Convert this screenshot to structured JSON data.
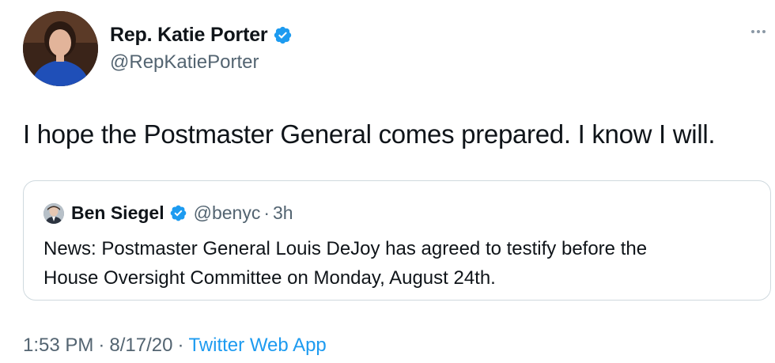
{
  "author": {
    "display_name": "Rep. Katie Porter",
    "handle": "@RepKatiePorter",
    "verified": true
  },
  "tweet": {
    "text": "I hope the Postmaster General comes prepared. I know I will."
  },
  "quoted_tweet": {
    "display_name": "Ben Siegel",
    "verified": true,
    "handle": "@benyc",
    "separator": "·",
    "time": "3h",
    "text_line1": "News: Postmaster General Louis DeJoy has agreed to testify before the",
    "text_line2": "House Oversight Committee on Monday, August 24th."
  },
  "meta": {
    "time": "1:53 PM",
    "separator": "·",
    "date": "8/17/20",
    "source": "Twitter Web App"
  },
  "icons": {
    "verified": "verified-badge-icon",
    "more": "more-options-icon"
  },
  "colors": {
    "verified_blue": "#1d9bf0",
    "link_blue": "#1d9bf0",
    "secondary_text": "#536471",
    "border": "#cfd9de"
  }
}
